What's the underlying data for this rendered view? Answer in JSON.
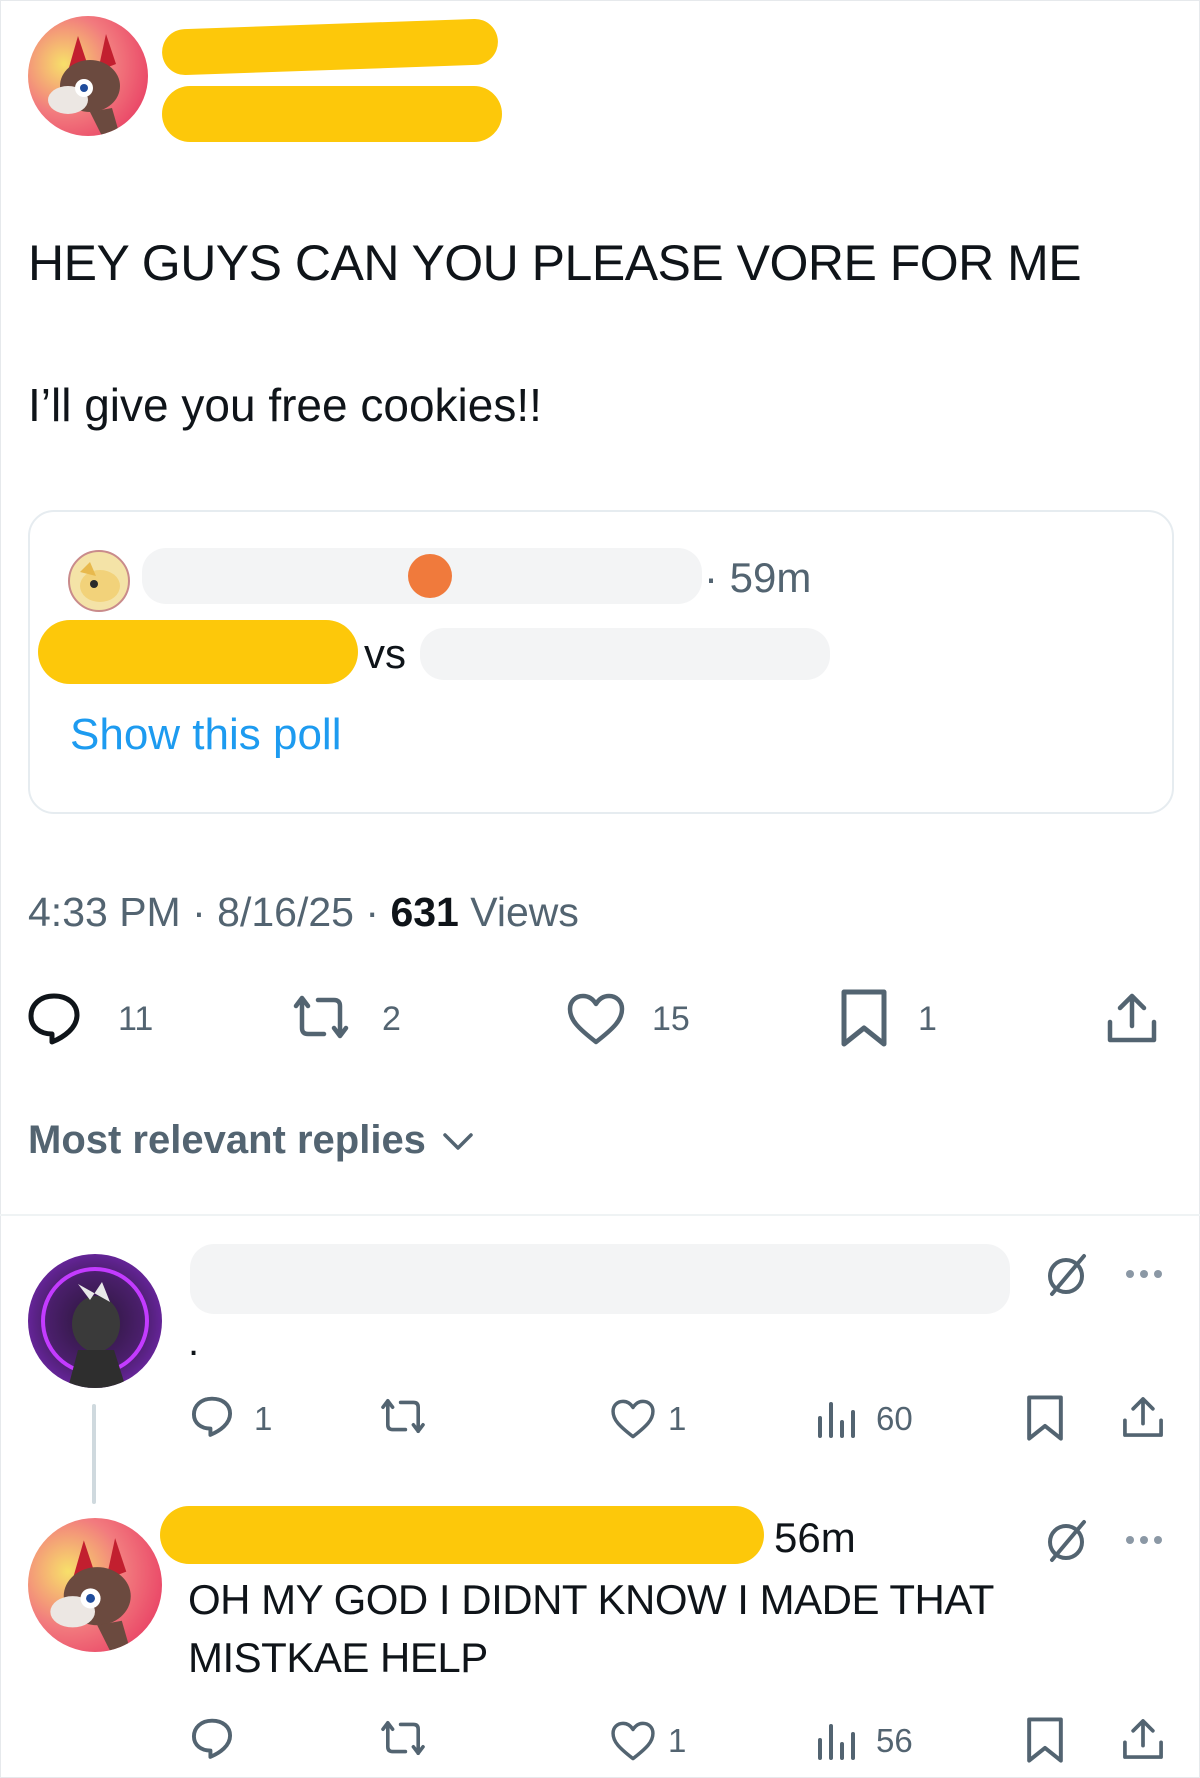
{
  "post": {
    "text_line1": "HEY GUYS CAN YOU PLEASE VORE FOR ME",
    "text_line2": "I’ll give you free cookies!!",
    "quote": {
      "time": "· 59m",
      "vs_text": "vs",
      "show_poll": "Show this poll"
    },
    "meta": {
      "time": "4:33 PM",
      "sep1": "·",
      "date": "8/16/25",
      "sep2": "·",
      "views_count": "631",
      "views_label": "Views"
    },
    "actions": {
      "replies": "11",
      "reposts": "2",
      "likes": "15",
      "bookmarks": "1"
    }
  },
  "replies_header": {
    "label": "Most relevant replies"
  },
  "replies": [
    {
      "text": ".",
      "actions": {
        "replies": "1",
        "reposts": "",
        "likes": "1",
        "views": "60"
      }
    },
    {
      "time": "56m",
      "text_line1": "OH MY GOD I DIDNT KNOW I MADE THAT",
      "text_line2": "MISTKAE HELP",
      "actions": {
        "replies": "",
        "reposts": "",
        "likes": "1",
        "views": "56"
      }
    }
  ],
  "colors": {
    "link_blue": "#1d9bf0",
    "muted_gray": "#536471",
    "redaction_yellow": "#fdc80a"
  }
}
